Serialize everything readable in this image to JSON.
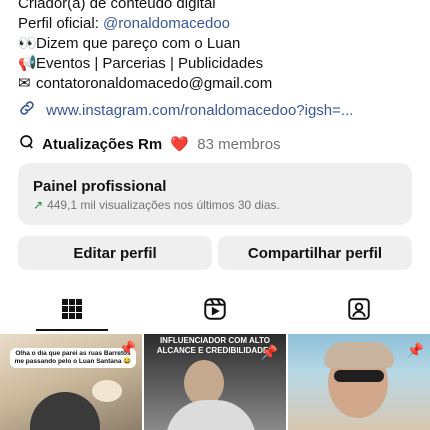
{
  "profile": {
    "category": "Criador(a) de conteúdo digital",
    "official_prefix": "Perfil oficial: ",
    "official_handle": "@ronaldomacedoo",
    "bio_line_1": "Dizem que pareço com o Luan",
    "bio_line_2": "Eventos | Parcerias | Publicidades",
    "email": "contatoronaldomacedo@gmail.com",
    "link": "www.instagram.com/ronaldomacedoo?igsh=..."
  },
  "community": {
    "name": "Atualizações Rm",
    "members": "83 membros"
  },
  "panel": {
    "title": "Painel profissional",
    "subtitle": "449,1 mil visualizações nos últimos 30 dias."
  },
  "buttons": {
    "edit": "Editar perfil",
    "share": "Compartilhar perfil"
  },
  "tabs": [
    {
      "name": "grid-icon",
      "selected": true
    },
    {
      "name": "reels-icon",
      "selected": false
    },
    {
      "name": "tagged-icon",
      "selected": false
    }
  ],
  "posts": [
    {
      "caption": "Olha o dia que parei as ruas Barretos me passando pelo o Luan Santana 😂"
    },
    {
      "caption": "INFLUENCIADOR COM ALTO ALCANCE E CREDIBILIDADE?"
    },
    {
      "caption": ""
    }
  ],
  "colors": {
    "link": "#385898",
    "panel_bg": "#efefef",
    "heart": "#e0245e"
  }
}
